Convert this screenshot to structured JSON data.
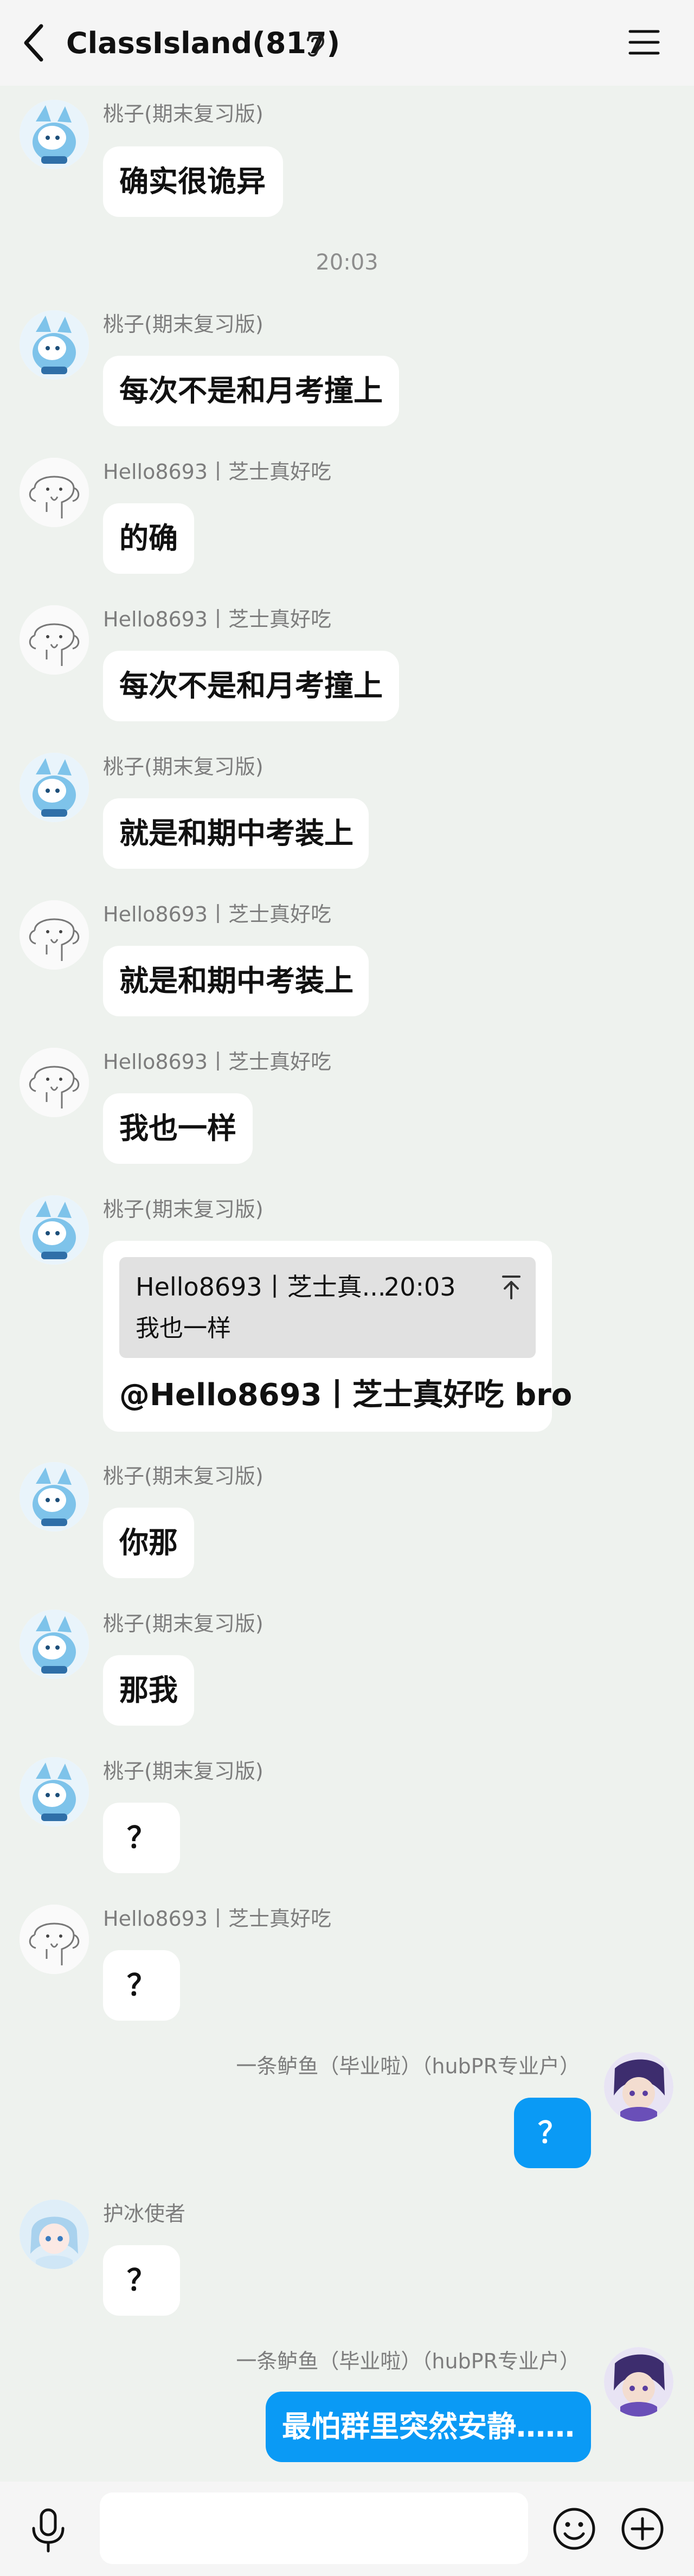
{
  "header": {
    "title": "ClassIsland(817)"
  },
  "input": {
    "placeholder": ""
  },
  "messages": [
    {
      "sender": "桃子(期末复习版)",
      "text": "确实很诡异"
    },
    {
      "time": "20:03"
    },
    {
      "sender": "桃子(期末复习版)",
      "text": "每次不是和月考撞上"
    },
    {
      "sender": "Hello8693丨芝士真好吃",
      "text": "的确"
    },
    {
      "sender": "Hello8693丨芝士真好吃",
      "text": "每次不是和月考撞上"
    },
    {
      "sender": "桃子(期末复习版)",
      "text": "就是和期中考装上"
    },
    {
      "sender": "Hello8693丨芝士真好吃",
      "text": "就是和期中考装上"
    },
    {
      "sender": "Hello8693丨芝士真好吃",
      "text": "我也一样"
    },
    {
      "sender": "桃子(期末复习版)",
      "quote": {
        "author": "Hello8693丨芝士真...",
        "time": "20:03",
        "text": "我也一样"
      },
      "text": "@Hello8693丨芝士真好吃 bro"
    },
    {
      "sender": "桃子(期末复习版)",
      "text": "你那"
    },
    {
      "sender": "桃子(期末复习版)",
      "text": "那我"
    },
    {
      "sender": "桃子(期末复习版)",
      "text": "？"
    },
    {
      "sender": "Hello8693丨芝士真好吃",
      "text": "？"
    },
    {
      "sender": "一条鲈鱼（毕业啦）（hubPR专业户）",
      "text": "？",
      "mine": true
    },
    {
      "sender": "护冰使者",
      "text": "？"
    },
    {
      "sender": "一条鲈鱼（毕业啦）（hubPR专业户）",
      "text": "最怕群里突然安静……",
      "mine": true
    }
  ],
  "icons": {
    "back": "back-arrow-icon",
    "ear": "ear-icon",
    "menu": "menu-icon",
    "jump": "jump-to-top-icon",
    "mic": "microphone-icon",
    "emoji": "emoji-icon",
    "plus": "plus-icon"
  },
  "colors": {
    "background": "#eef2ee",
    "bubble": "#ffffff",
    "my_bubble": "#0a9af5",
    "header": "#f5f5f5"
  }
}
